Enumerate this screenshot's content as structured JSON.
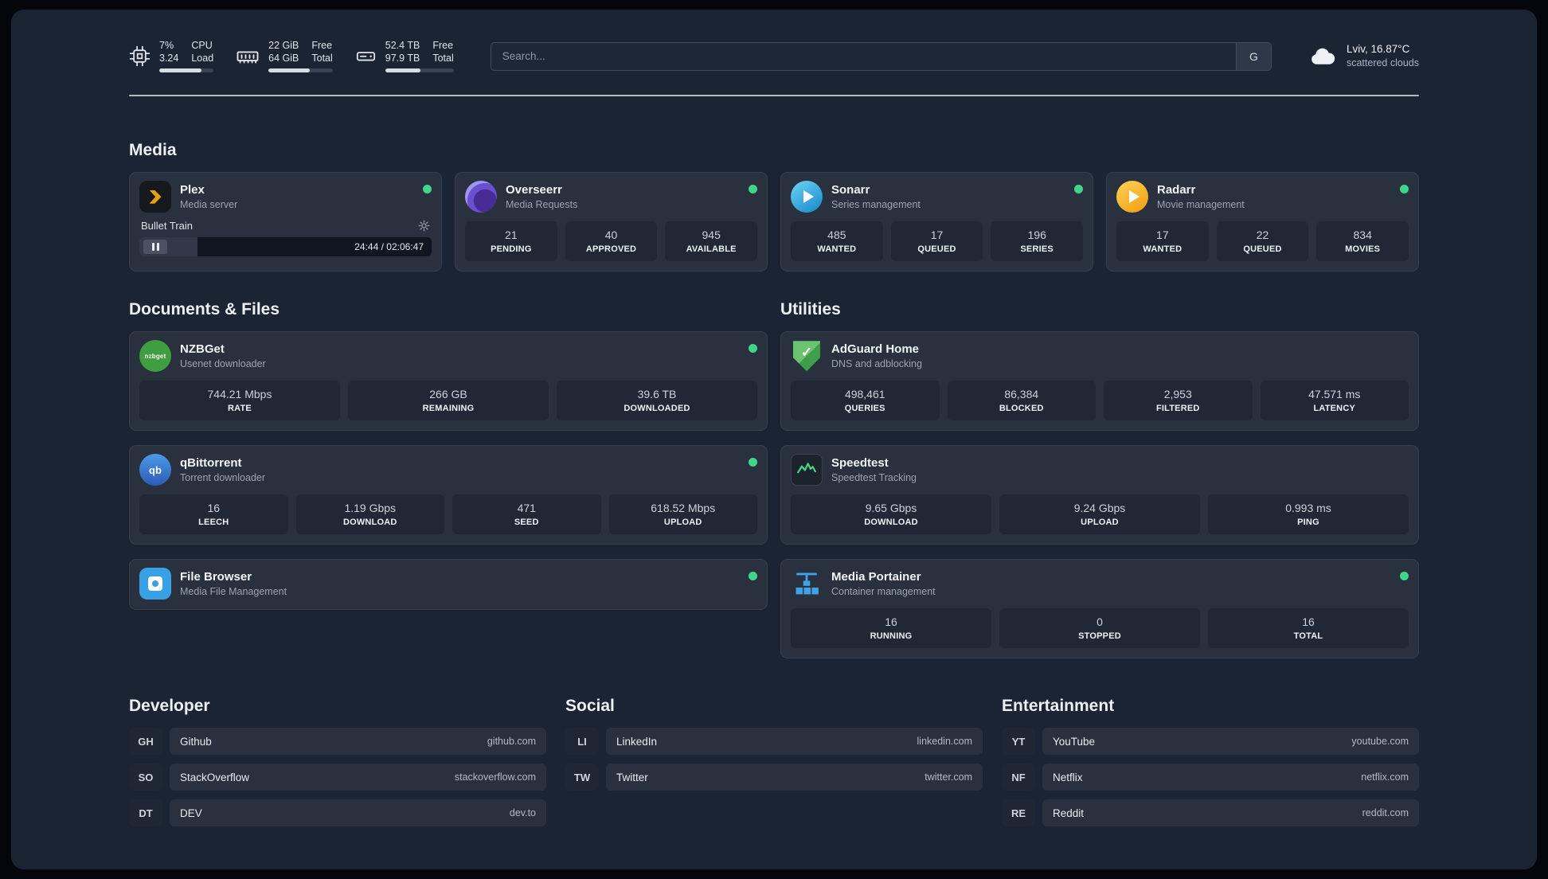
{
  "colors": {
    "background": "#1b2433",
    "card": "#29313f",
    "tile": "#202836",
    "status_online": "#3fd68a",
    "accent_plex": "#e5a00d",
    "accent_sonarr": "#35c5f4",
    "accent_radarr": "#f7b733",
    "accent_adguard": "#48a852",
    "accent_speedtest_line": "#3ddc84",
    "accent_portainer": "#3fa3e6"
  },
  "icons": {
    "adguard_check": "✓",
    "qbittorrent_label": "qb",
    "nzbget_label": "nzbget"
  },
  "topbar": {
    "resources": [
      {
        "icon": "cpu-icon",
        "values": [
          "7%",
          "3.24"
        ],
        "labels": [
          "CPU",
          "Load"
        ],
        "progress_percent": 78
      },
      {
        "icon": "memory-icon",
        "values": [
          "22 GiB",
          "64 GiB"
        ],
        "labels": [
          "Free",
          "Total"
        ],
        "progress_percent": 64
      },
      {
        "icon": "disk-icon",
        "values": [
          "52.4 TB",
          "97.9 TB"
        ],
        "labels": [
          "Free",
          "Total"
        ],
        "progress_percent": 52
      }
    ],
    "search": {
      "placeholder": "Search...",
      "provider_label": "G"
    },
    "weather": {
      "icon": "cloud-icon",
      "location": "Lviv, 16.87°C",
      "condition": "scattered clouds"
    }
  },
  "sections": {
    "media": {
      "title": "Media",
      "plex": {
        "name": "Plex",
        "desc": "Media server",
        "online": true,
        "player": {
          "title": "Bullet Train",
          "time": "24:44 / 02:06:47",
          "progress_percent": 20
        }
      },
      "overseerr": {
        "name": "Overseerr",
        "desc": "Media Requests",
        "online": true,
        "stats": [
          {
            "value": "21",
            "label": "PENDING"
          },
          {
            "value": "40",
            "label": "APPROVED"
          },
          {
            "value": "945",
            "label": "AVAILABLE"
          }
        ]
      },
      "sonarr": {
        "name": "Sonarr",
        "desc": "Series management",
        "online": true,
        "stats": [
          {
            "value": "485",
            "label": "WANTED"
          },
          {
            "value": "17",
            "label": "QUEUED"
          },
          {
            "value": "196",
            "label": "SERIES"
          }
        ]
      },
      "radarr": {
        "name": "Radarr",
        "desc": "Movie management",
        "online": true,
        "stats": [
          {
            "value": "17",
            "label": "WANTED"
          },
          {
            "value": "22",
            "label": "QUEUED"
          },
          {
            "value": "834",
            "label": "MOVIES"
          }
        ]
      }
    },
    "documents": {
      "title": "Documents & Files",
      "nzbget": {
        "name": "NZBGet",
        "desc": "Usenet downloader",
        "online": true,
        "stats": [
          {
            "value": "744.21 Mbps",
            "label": "RATE"
          },
          {
            "value": "266 GB",
            "label": "REMAINING"
          },
          {
            "value": "39.6 TB",
            "label": "DOWNLOADED"
          }
        ]
      },
      "qbittorrent": {
        "name": "qBittorrent",
        "desc": "Torrent downloader",
        "online": true,
        "stats": [
          {
            "value": "16",
            "label": "LEECH"
          },
          {
            "value": "1.19 Gbps",
            "label": "DOWNLOAD"
          },
          {
            "value": "471",
            "label": "SEED"
          },
          {
            "value": "618.52 Mbps",
            "label": "UPLOAD"
          }
        ]
      },
      "filebrowser": {
        "name": "File Browser",
        "desc": "Media File Management",
        "online": true
      }
    },
    "utilities": {
      "title": "Utilities",
      "adguard": {
        "name": "AdGuard Home",
        "desc": "DNS and adblocking",
        "stats": [
          {
            "value": "498,461",
            "label": "QUERIES"
          },
          {
            "value": "86,384",
            "label": "BLOCKED"
          },
          {
            "value": "2,953",
            "label": "FILTERED"
          },
          {
            "value": "47.571 ms",
            "label": "LATENCY"
          }
        ]
      },
      "speedtest": {
        "name": "Speedtest",
        "desc": "Speedtest Tracking",
        "stats": [
          {
            "value": "9.65 Gbps",
            "label": "DOWNLOAD"
          },
          {
            "value": "9.24 Gbps",
            "label": "UPLOAD"
          },
          {
            "value": "0.993 ms",
            "label": "PING"
          }
        ]
      },
      "portainer": {
        "name": "Media Portainer",
        "desc": "Container management",
        "online": true,
        "stats": [
          {
            "value": "16",
            "label": "RUNNING"
          },
          {
            "value": "0",
            "label": "STOPPED"
          },
          {
            "value": "16",
            "label": "TOTAL"
          }
        ]
      }
    }
  },
  "bookmarks": [
    {
      "title": "Developer",
      "items": [
        {
          "abbr": "GH",
          "name": "Github",
          "url": "github.com"
        },
        {
          "abbr": "SO",
          "name": "StackOverflow",
          "url": "stackoverflow.com"
        },
        {
          "abbr": "DT",
          "name": "DEV",
          "url": "dev.to"
        }
      ]
    },
    {
      "title": "Social",
      "items": [
        {
          "abbr": "LI",
          "name": "LinkedIn",
          "url": "linkedin.com"
        },
        {
          "abbr": "TW",
          "name": "Twitter",
          "url": "twitter.com"
        }
      ]
    },
    {
      "title": "Entertainment",
      "items": [
        {
          "abbr": "YT",
          "name": "YouTube",
          "url": "youtube.com"
        },
        {
          "abbr": "NF",
          "name": "Netflix",
          "url": "netflix.com"
        },
        {
          "abbr": "RE",
          "name": "Reddit",
          "url": "reddit.com"
        }
      ]
    }
  ]
}
